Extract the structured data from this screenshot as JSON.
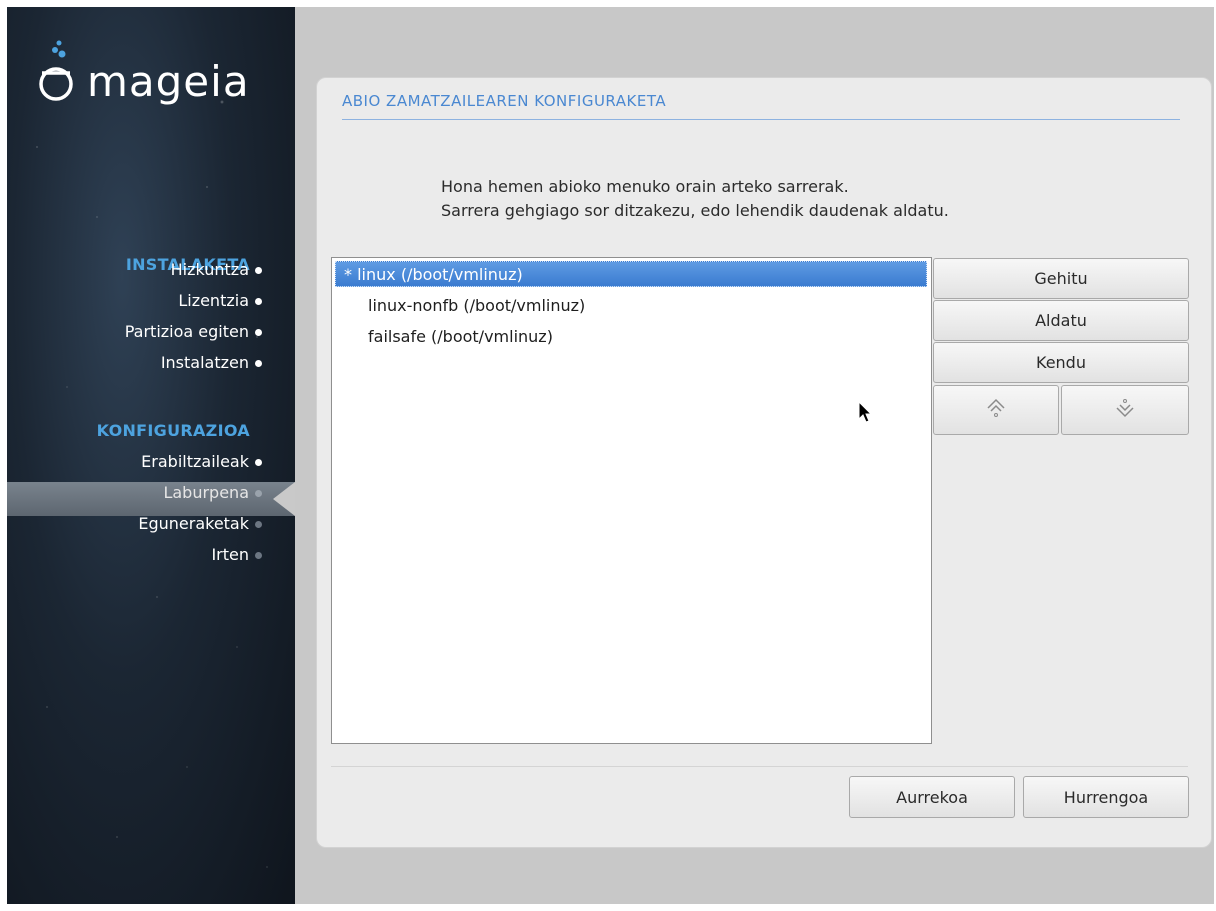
{
  "brand": {
    "name": "mageia"
  },
  "sidebar": {
    "section_install": "INSTALAKETA",
    "install_items": [
      {
        "label": "Hizkuntza",
        "state": "done"
      },
      {
        "label": "Lizentzia",
        "state": "done"
      },
      {
        "label": "Partizioa egiten",
        "state": "done"
      },
      {
        "label": "Instalatzen",
        "state": "done"
      }
    ],
    "section_config": "KONFIGURAZIOA",
    "config_items": [
      {
        "label": "Erabiltzaileak",
        "state": "done"
      },
      {
        "label": "Laburpena",
        "state": "active"
      },
      {
        "label": "Eguneraketak",
        "state": "pending"
      },
      {
        "label": "Irten",
        "state": "pending"
      }
    ]
  },
  "dialog": {
    "title": "ABIO ZAMATZAILEAREN KONFIGURAKETA",
    "intro_line1": "Hona hemen abioko menuko orain arteko sarrerak.",
    "intro_line2": "Sarrera gehgiago sor ditzakezu, edo lehendik daudenak aldatu.",
    "entries": [
      {
        "label": "* linux (/boot/vmlinuz)",
        "selected": true
      },
      {
        "label": "linux-nonfb (/boot/vmlinuz)",
        "selected": false
      },
      {
        "label": "failsafe (/boot/vmlinuz)",
        "selected": false
      }
    ],
    "buttons": {
      "add": "Gehitu",
      "modify": "Aldatu",
      "remove": "Kendu",
      "up_icon": "arrow-up-icon",
      "down_icon": "arrow-down-icon"
    },
    "nav": {
      "previous": "Aurrekoa",
      "next": "Hurrengoa"
    }
  },
  "colors": {
    "accent": "#4da3df",
    "title": "#4a88d1",
    "selection": "#3a7bd0"
  }
}
